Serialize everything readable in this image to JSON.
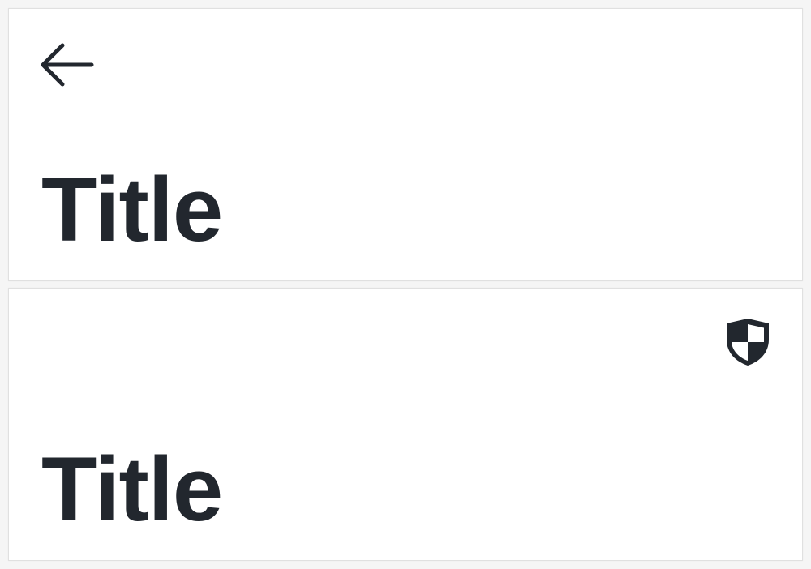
{
  "colors": {
    "background": "#f5f5f5",
    "card": "#ffffff",
    "text": "#22272e",
    "border": "#e0e0e0"
  },
  "top_bar": {
    "leading_icon": "arrow-left-icon",
    "title": "Title"
  },
  "bottom_bar": {
    "trailing_icon": "shield-icon",
    "title": "Title"
  }
}
